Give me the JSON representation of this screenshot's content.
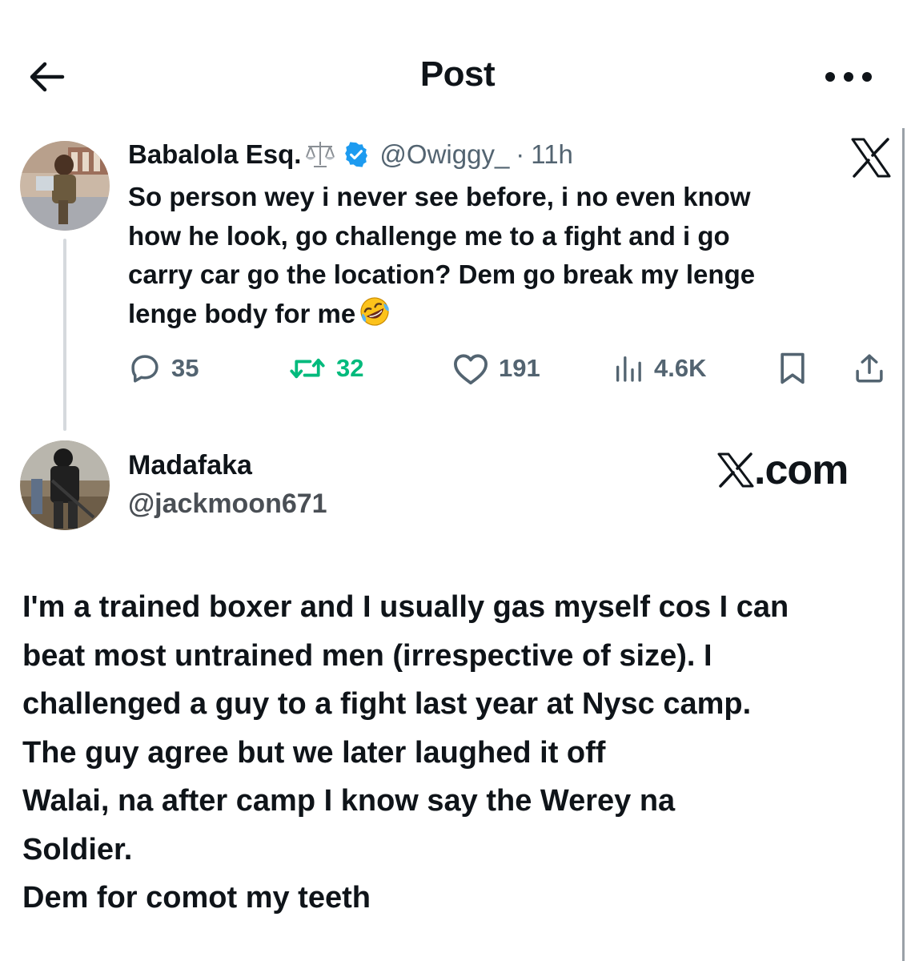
{
  "header": {
    "title": "Post",
    "back_icon": "arrow-left-icon",
    "more_icon": "more-horizontal-icon"
  },
  "quoted_post": {
    "display_name": "Babalola Esq.",
    "name_emoji": "scales-icon",
    "verified_icon": "verified-badge-icon",
    "handle": "@Owiggy_",
    "separator": "·",
    "time": "11h",
    "body_lines": [
      "So person wey i never see before, i no even know",
      "how he look, go challenge me to a fight and i go",
      "carry car go the location? Dem go break my lenge",
      "lenge body for me"
    ],
    "body_emoji": "rolling-laughing-emoji",
    "stats": {
      "replies": "35",
      "reposts": "32",
      "likes": "191",
      "views": "4.6K"
    }
  },
  "reply": {
    "display_name": "Madafaka",
    "handle": "@jackmoon671",
    "body_lines": [
      "I'm a trained boxer and I usually gas myself cos I can",
      "beat most untrained men (irrespective of size). I",
      "challenged a guy to a fight last year at Nysc camp.",
      "The guy agree but we later laughed it off",
      "Walai, na after camp I know say the Werey na",
      "Soldier.",
      "Dem for comot my teeth"
    ]
  },
  "watermark": {
    "text": ".com"
  },
  "colors": {
    "text": "#0f1419",
    "secondary": "#536471",
    "verified": "#1d9bf0",
    "repost": "#00ba7c",
    "thread_line": "#d5d9dd"
  }
}
